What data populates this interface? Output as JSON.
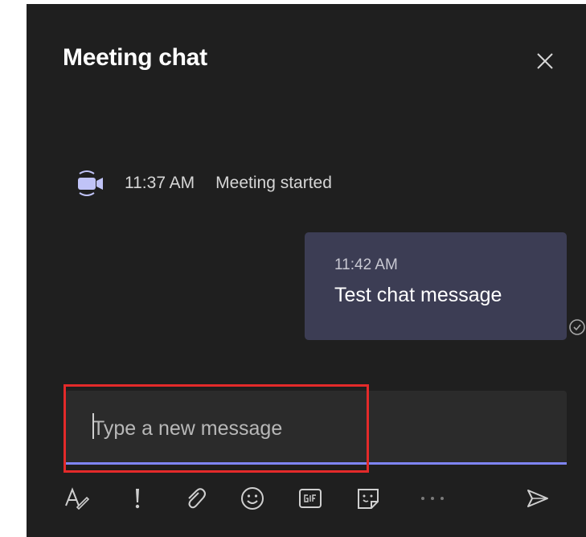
{
  "header": {
    "title": "Meeting chat",
    "close_icon": "close-icon"
  },
  "event": {
    "icon": "video-camera-icon",
    "time": "11:37 AM",
    "text": "Meeting started"
  },
  "message": {
    "time": "11:42 AM",
    "text": "Test chat message",
    "status_icon": "message-sent-status-icon"
  },
  "compose": {
    "placeholder": "Type a new message",
    "value": ""
  },
  "toolbar": {
    "items": [
      {
        "name": "format-icon"
      },
      {
        "name": "important-icon"
      },
      {
        "name": "attach-icon"
      },
      {
        "name": "emoji-icon"
      },
      {
        "name": "gif-icon"
      },
      {
        "name": "sticker-icon"
      },
      {
        "name": "more-options-icon"
      },
      {
        "name": "send-icon"
      }
    ]
  },
  "colors": {
    "panel_bg": "#1f1f1f",
    "bubble_bg": "#3c3d54",
    "accent": "#7f85f5",
    "highlight": "#e32a2a",
    "icon": "#cfcfcf"
  }
}
